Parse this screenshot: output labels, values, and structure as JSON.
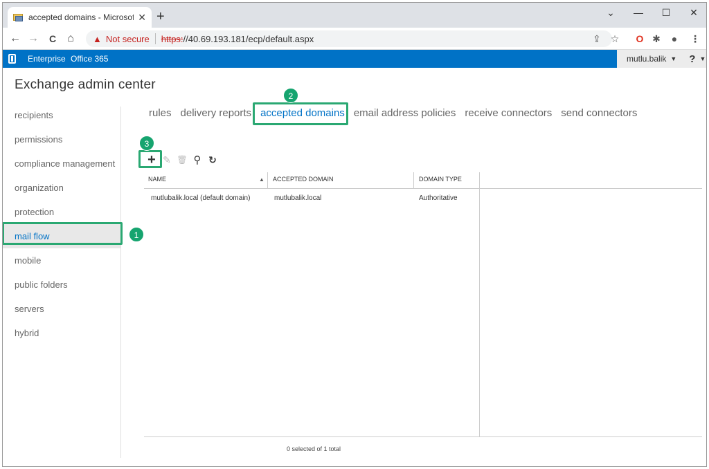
{
  "browser": {
    "tab_title": "accepted domains - Microsoft Ex",
    "tab_close": "✕",
    "new_tab": "+",
    "window_controls": [
      "⌄",
      "—",
      "☐",
      "✕"
    ],
    "nav": {
      "back": "←",
      "forward": "→",
      "reload": "C",
      "home": "⌂"
    },
    "address": {
      "warning_text": "Not secure",
      "scheme": "https:",
      "rest": "//40.69.193.181/ecp/default.aspx"
    }
  },
  "o365": {
    "enterprise": "Enterprise",
    "office365": "Office 365",
    "user": "mutlu.balik",
    "user_caret": "▼",
    "help": "?",
    "help_caret": "▼"
  },
  "eac": {
    "title": "Exchange admin center"
  },
  "leftnav": [
    {
      "label": "recipients"
    },
    {
      "label": "permissions"
    },
    {
      "label": "compliance management"
    },
    {
      "label": "organization"
    },
    {
      "label": "protection"
    },
    {
      "label": "mail flow",
      "active": true
    },
    {
      "label": "mobile"
    },
    {
      "label": "public folders"
    },
    {
      "label": "servers"
    },
    {
      "label": "hybrid"
    }
  ],
  "tabs": [
    {
      "label": "rules"
    },
    {
      "label": "delivery reports"
    },
    {
      "label": "accepted domains",
      "active": true
    },
    {
      "label": "email address policies"
    },
    {
      "label": "receive connectors"
    },
    {
      "label": "send connectors"
    }
  ],
  "badges": {
    "one": "1",
    "two": "2",
    "three": "3"
  },
  "toolbar": {
    "add": "+",
    "edit": "✎",
    "delete": "🗑",
    "search": "⚲",
    "refresh": "↻"
  },
  "grid": {
    "columns": [
      "NAME",
      "ACCEPTED DOMAIN",
      "DOMAIN TYPE"
    ],
    "sort_indicator": "▲",
    "rows": [
      {
        "name": "mutlubalik.local (default domain)",
        "domain": "mutlubalik.local",
        "type": "Authoritative"
      }
    ],
    "status": "0 selected of 1 total"
  },
  "colors": {
    "accent": "#0072c6",
    "highlight": "#2aa872",
    "badge": "#16a46f"
  }
}
